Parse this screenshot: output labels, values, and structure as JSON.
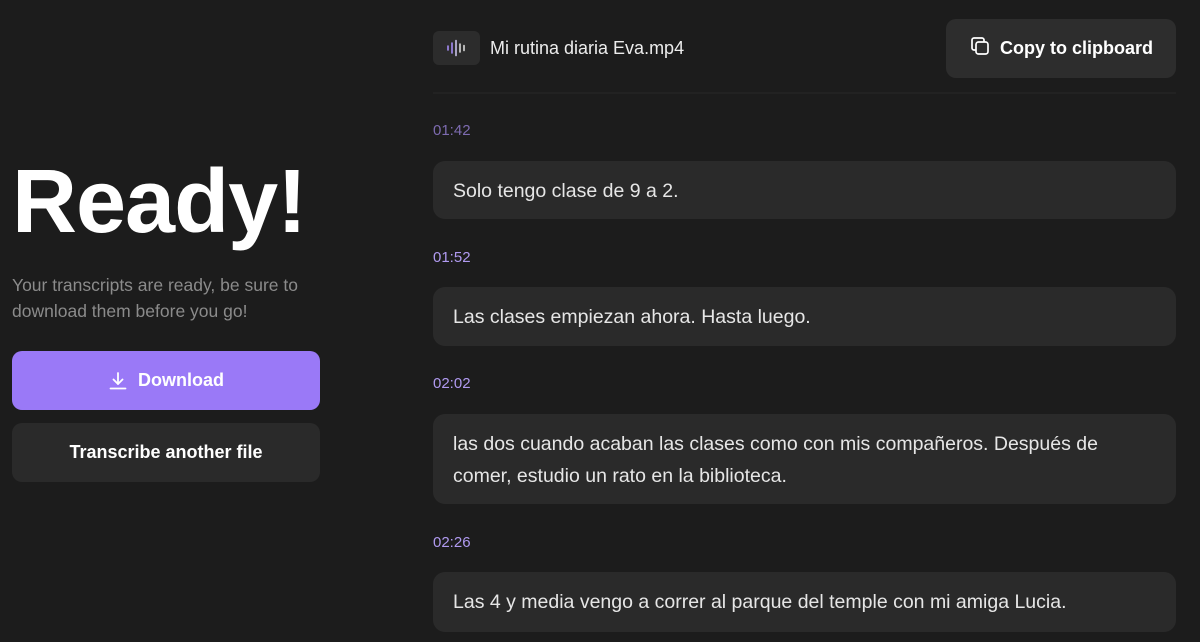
{
  "left": {
    "headline": "Ready!",
    "subtitle": "Your transcripts are ready, be sure to download them before you go!",
    "download_label": "Download",
    "another_label": "Transcribe another file"
  },
  "file": {
    "name": "Mi rutina diaria Eva.mp4",
    "icon": "audio-wave-icon"
  },
  "toolbar": {
    "copy_label": "Copy to clipboard"
  },
  "segments": [
    {
      "time": "01:42",
      "text": "Solo tengo clase de 9 a 2."
    },
    {
      "time": "01:52",
      "text": "Las clases empiezan ahora. Hasta luego."
    },
    {
      "time": "02:02",
      "text": "las dos cuando acaban las clases como con mis compañeros. Después de comer, estudio un rato en la biblioteca."
    },
    {
      "time": "02:26",
      "text": "Las 4 y media vengo a correr al parque del temple con mi amiga Lucia."
    }
  ],
  "colors": {
    "background": "#1c1c1c",
    "accent": "#9a79f7",
    "timestamp": "#b09af0",
    "bubble": "#2a2a2a"
  }
}
